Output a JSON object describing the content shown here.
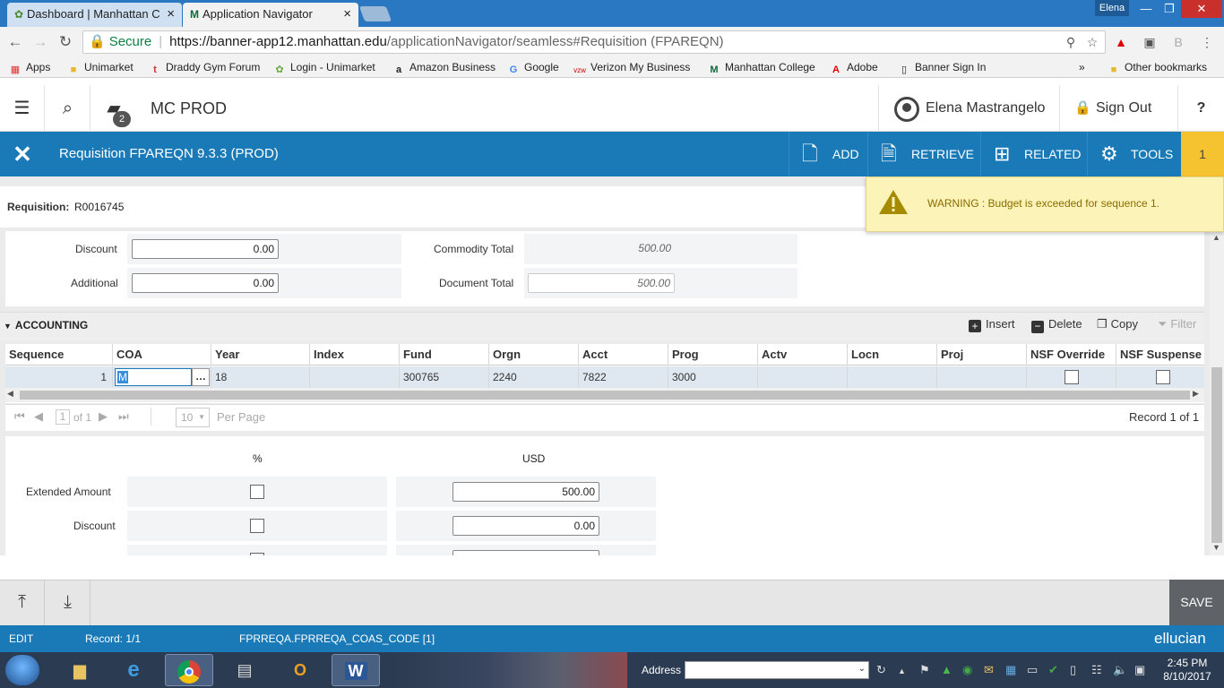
{
  "browser": {
    "tabs": [
      {
        "label": "Dashboard | Manhattan C"
      },
      {
        "label": "Application Navigator"
      }
    ],
    "window_user": "Elena",
    "secure_label": "Secure",
    "url_host": "https://banner-app12.manhattan.edu",
    "url_path": "/applicationNavigator/seamless#Requisition (FPAREQN)",
    "bookmarks": [
      "Apps",
      "Unimarket",
      "Draddy Gym Forum",
      "Login - Unimarket",
      "Amazon Business",
      "Google",
      "Verizon My Business",
      "Manhattan College",
      "Adobe",
      "Banner Sign In"
    ],
    "other_bookmarks": "Other bookmarks"
  },
  "header": {
    "env": "MC PROD",
    "recent_count": "2",
    "user": "Elena Mastrangelo",
    "sign_out": "Sign Out",
    "help": "?"
  },
  "toolbar": {
    "title": "Requisition FPAREQN 9.3.3 (PROD)",
    "add": "ADD",
    "retrieve": "RETRIEVE",
    "related": "RELATED",
    "tools": "TOOLS",
    "notification_count": "1"
  },
  "warning": {
    "text": "WARNING : Budget is exceeded for sequence 1."
  },
  "requisition": {
    "label": "Requisition:",
    "value": "R0016745"
  },
  "totals": {
    "discount_label": "Discount",
    "discount": "0.00",
    "additional_label": "Additional",
    "additional": "0.00",
    "commodity_total_label": "Commodity Total",
    "commodity_total": "500.00",
    "document_total_label": "Document Total",
    "document_total": "500.00"
  },
  "accounting": {
    "title": "ACCOUNTING",
    "actions": {
      "insert": "Insert",
      "delete": "Delete",
      "copy": "Copy",
      "filter": "Filter"
    },
    "columns": [
      "Sequence",
      "COA",
      "Year",
      "Index",
      "Fund",
      "Orgn",
      "Acct",
      "Prog",
      "Actv",
      "Locn",
      "Proj",
      "NSF Override",
      "NSF Suspense"
    ],
    "row": {
      "sequence": "1",
      "coa": "M",
      "year": "18",
      "index": "",
      "fund": "300765",
      "orgn": "2240",
      "acct": "7822",
      "prog": "3000",
      "actv": "",
      "locn": "",
      "proj": ""
    },
    "pager": {
      "page": "1",
      "of": "of 1",
      "per_page": "10",
      "per_page_label": "Per Page",
      "record": "Record 1 of 1"
    }
  },
  "amounts": {
    "pct_header": "%",
    "usd_header": "USD",
    "extended_label": "Extended Amount",
    "extended": "500.00",
    "discount_label": "Discount",
    "discount": "0.00"
  },
  "footer": {
    "save": "SAVE",
    "mode": "EDIT",
    "record": "Record: 1/1",
    "field": "FPRREQA.FPRREQA_COAS_CODE [1]",
    "brand": "ellucian"
  },
  "taskbar": {
    "address_label": "Address",
    "time": "2:45 PM",
    "date": "8/10/2017"
  }
}
